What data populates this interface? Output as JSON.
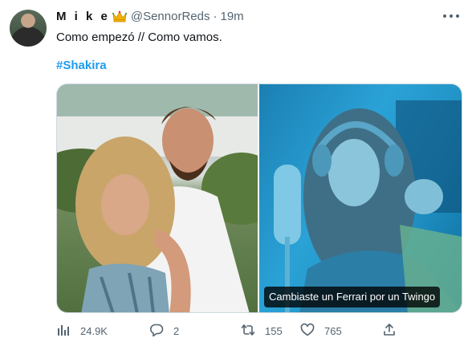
{
  "author": {
    "display_name": "M i k e",
    "badge_icon": "crown-emoji-icon",
    "handle": "@SennorReds",
    "separator": "·",
    "time": "19m"
  },
  "tweet": {
    "text": "Como empezó // Como vamos.",
    "hashtag": "#Shakira"
  },
  "media": {
    "left_photo_icon": "couple-photo",
    "right_photo_icon": "singer-photo",
    "right_caption": "Cambiaste un Ferrari por un Twingo"
  },
  "actions": {
    "views": "24.9K",
    "replies": "2",
    "retweets": "155",
    "likes": "765"
  },
  "colors": {
    "accent": "#1d9bf0",
    "muted": "#536471",
    "text": "#0f1419"
  }
}
